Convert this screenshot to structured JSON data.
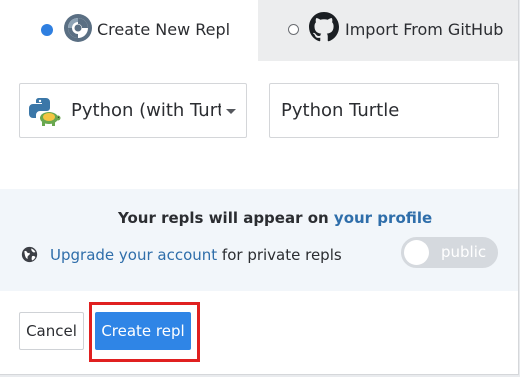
{
  "tabs": {
    "create": {
      "label": "Create New Repl",
      "selected": true
    },
    "import": {
      "label": "Import From GitHub",
      "selected": false
    }
  },
  "language": {
    "value": "Python (with Turt",
    "icon": "python-turtle-icon"
  },
  "name_input": {
    "value": "Python Turtle"
  },
  "info": {
    "prefix": "Your repls will appear on ",
    "profile_link": "your profile"
  },
  "privacy": {
    "upgrade_link": "Upgrade your account",
    "suffix": " for private repls",
    "toggle_label": "public",
    "toggle_on": false
  },
  "buttons": {
    "cancel": "Cancel",
    "create": "Create repl"
  },
  "colors": {
    "accent": "#2f85e6",
    "link": "#2f6eaa",
    "highlight": "#e02020",
    "info_bg": "#f2f6fa"
  }
}
